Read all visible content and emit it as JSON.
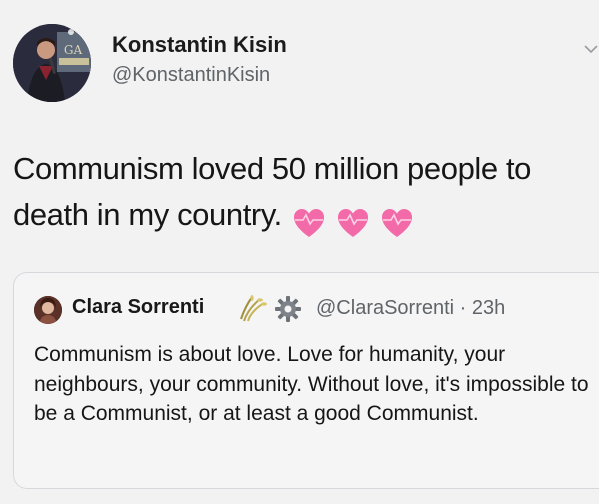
{
  "author": {
    "name": "Konstantin Kisin",
    "handle": "@KonstantinKisin",
    "avatar_icon": "comedian-with-microphone-avatar"
  },
  "tweet": {
    "text": "Communism loved 50 million people to death in my country.",
    "emoji": [
      "heartpulse",
      "heartpulse",
      "heartpulse"
    ]
  },
  "quoted_tweet": {
    "name": "Clara Sorrenti",
    "name_emoji": [
      "sheaf-of-rice",
      "gear"
    ],
    "handle_time": "@ClaraSorrenti · 23h",
    "text": "Communism is about love. Love for humanity, your neighbours, your community. Without love, it's impossible to be a Communist, or at least a good Communist."
  },
  "colors": {
    "background": "#f2f2f3",
    "secondary_text": "#5f6468",
    "heart_pink": "#f26aa8"
  }
}
